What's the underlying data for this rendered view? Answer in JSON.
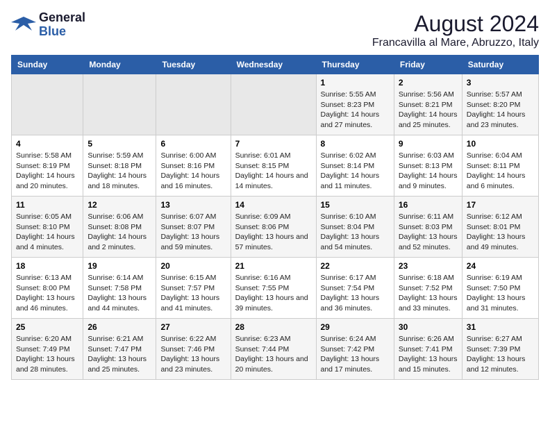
{
  "logo": {
    "line1": "General",
    "line2": "Blue"
  },
  "title": "August 2024",
  "subtitle": "Francavilla al Mare, Abruzzo, Italy",
  "header_color": "#2b5ea7",
  "days_of_week": [
    "Sunday",
    "Monday",
    "Tuesday",
    "Wednesday",
    "Thursday",
    "Friday",
    "Saturday"
  ],
  "weeks": [
    [
      {
        "day": "",
        "content": ""
      },
      {
        "day": "",
        "content": ""
      },
      {
        "day": "",
        "content": ""
      },
      {
        "day": "",
        "content": ""
      },
      {
        "day": "1",
        "content": "Sunrise: 5:55 AM\nSunset: 8:23 PM\nDaylight: 14 hours\nand 27 minutes."
      },
      {
        "day": "2",
        "content": "Sunrise: 5:56 AM\nSunset: 8:21 PM\nDaylight: 14 hours\nand 25 minutes."
      },
      {
        "day": "3",
        "content": "Sunrise: 5:57 AM\nSunset: 8:20 PM\nDaylight: 14 hours\nand 23 minutes."
      }
    ],
    [
      {
        "day": "4",
        "content": "Sunrise: 5:58 AM\nSunset: 8:19 PM\nDaylight: 14 hours\nand 20 minutes."
      },
      {
        "day": "5",
        "content": "Sunrise: 5:59 AM\nSunset: 8:18 PM\nDaylight: 14 hours\nand 18 minutes."
      },
      {
        "day": "6",
        "content": "Sunrise: 6:00 AM\nSunset: 8:16 PM\nDaylight: 14 hours\nand 16 minutes."
      },
      {
        "day": "7",
        "content": "Sunrise: 6:01 AM\nSunset: 8:15 PM\nDaylight: 14 hours\nand 14 minutes."
      },
      {
        "day": "8",
        "content": "Sunrise: 6:02 AM\nSunset: 8:14 PM\nDaylight: 14 hours\nand 11 minutes."
      },
      {
        "day": "9",
        "content": "Sunrise: 6:03 AM\nSunset: 8:13 PM\nDaylight: 14 hours\nand 9 minutes."
      },
      {
        "day": "10",
        "content": "Sunrise: 6:04 AM\nSunset: 8:11 PM\nDaylight: 14 hours\nand 6 minutes."
      }
    ],
    [
      {
        "day": "11",
        "content": "Sunrise: 6:05 AM\nSunset: 8:10 PM\nDaylight: 14 hours\nand 4 minutes."
      },
      {
        "day": "12",
        "content": "Sunrise: 6:06 AM\nSunset: 8:08 PM\nDaylight: 14 hours\nand 2 minutes."
      },
      {
        "day": "13",
        "content": "Sunrise: 6:07 AM\nSunset: 8:07 PM\nDaylight: 13 hours\nand 59 minutes."
      },
      {
        "day": "14",
        "content": "Sunrise: 6:09 AM\nSunset: 8:06 PM\nDaylight: 13 hours\nand 57 minutes."
      },
      {
        "day": "15",
        "content": "Sunrise: 6:10 AM\nSunset: 8:04 PM\nDaylight: 13 hours\nand 54 minutes."
      },
      {
        "day": "16",
        "content": "Sunrise: 6:11 AM\nSunset: 8:03 PM\nDaylight: 13 hours\nand 52 minutes."
      },
      {
        "day": "17",
        "content": "Sunrise: 6:12 AM\nSunset: 8:01 PM\nDaylight: 13 hours\nand 49 minutes."
      }
    ],
    [
      {
        "day": "18",
        "content": "Sunrise: 6:13 AM\nSunset: 8:00 PM\nDaylight: 13 hours\nand 46 minutes."
      },
      {
        "day": "19",
        "content": "Sunrise: 6:14 AM\nSunset: 7:58 PM\nDaylight: 13 hours\nand 44 minutes."
      },
      {
        "day": "20",
        "content": "Sunrise: 6:15 AM\nSunset: 7:57 PM\nDaylight: 13 hours\nand 41 minutes."
      },
      {
        "day": "21",
        "content": "Sunrise: 6:16 AM\nSunset: 7:55 PM\nDaylight: 13 hours\nand 39 minutes."
      },
      {
        "day": "22",
        "content": "Sunrise: 6:17 AM\nSunset: 7:54 PM\nDaylight: 13 hours\nand 36 minutes."
      },
      {
        "day": "23",
        "content": "Sunrise: 6:18 AM\nSunset: 7:52 PM\nDaylight: 13 hours\nand 33 minutes."
      },
      {
        "day": "24",
        "content": "Sunrise: 6:19 AM\nSunset: 7:50 PM\nDaylight: 13 hours\nand 31 minutes."
      }
    ],
    [
      {
        "day": "25",
        "content": "Sunrise: 6:20 AM\nSunset: 7:49 PM\nDaylight: 13 hours\nand 28 minutes."
      },
      {
        "day": "26",
        "content": "Sunrise: 6:21 AM\nSunset: 7:47 PM\nDaylight: 13 hours\nand 25 minutes."
      },
      {
        "day": "27",
        "content": "Sunrise: 6:22 AM\nSunset: 7:46 PM\nDaylight: 13 hours\nand 23 minutes."
      },
      {
        "day": "28",
        "content": "Sunrise: 6:23 AM\nSunset: 7:44 PM\nDaylight: 13 hours\nand 20 minutes."
      },
      {
        "day": "29",
        "content": "Sunrise: 6:24 AM\nSunset: 7:42 PM\nDaylight: 13 hours\nand 17 minutes."
      },
      {
        "day": "30",
        "content": "Sunrise: 6:26 AM\nSunset: 7:41 PM\nDaylight: 13 hours\nand 15 minutes."
      },
      {
        "day": "31",
        "content": "Sunrise: 6:27 AM\nSunset: 7:39 PM\nDaylight: 13 hours\nand 12 minutes."
      }
    ]
  ]
}
